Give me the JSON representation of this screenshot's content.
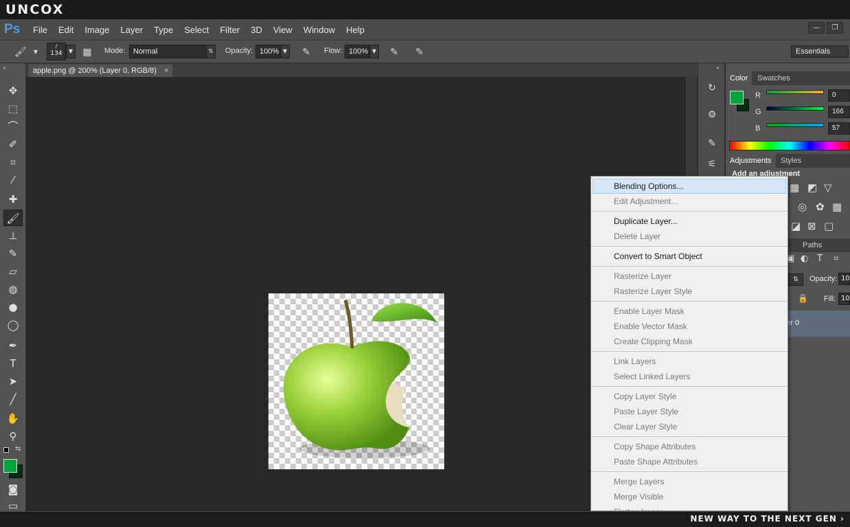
{
  "brand": {
    "logo": "UNCOX",
    "tagline": "NEW WAY TO THE NEXT GEN ›"
  },
  "app": {
    "logo": "Ps"
  },
  "menu": [
    "File",
    "Edit",
    "Image",
    "Layer",
    "Type",
    "Select",
    "Filter",
    "3D",
    "View",
    "Window",
    "Help"
  ],
  "window_controls": {
    "minimize": "—",
    "restore": "❐"
  },
  "options": {
    "brush_size": "134",
    "mode_label": "Mode:",
    "mode_value": "Normal",
    "opacity_label": "Opacity:",
    "opacity_value": "100%",
    "flow_label": "Flow:",
    "flow_value": "100%",
    "workspace": "Essentials"
  },
  "document": {
    "tab_title": "apple.png @ 200% (Layer 0, RGB/8)",
    "close": "×"
  },
  "color_panel": {
    "tabs": [
      "Color",
      "Swatches"
    ],
    "r_label": "R",
    "r_value": "0",
    "g_label": "G",
    "g_value": "166",
    "b_label": "B",
    "b_value": "57",
    "foreground": "#00a639",
    "background": "#003010"
  },
  "adjustments_panel": {
    "tabs": [
      "Adjustments",
      "Styles"
    ],
    "heading": "Add an adjustment"
  },
  "layers_panel": {
    "tab": "Paths",
    "opacity_label": "Opacity:",
    "opacity_value": "10",
    "fill_label": "Fill:",
    "fill_value": "10",
    "layer_name": "er 0"
  },
  "context_menu": {
    "groups": [
      [
        {
          "label": "Blending Options...",
          "state": "highlight"
        },
        {
          "label": "Edit Adjustment...",
          "state": "disabled"
        }
      ],
      [
        {
          "label": "Duplicate Layer...",
          "state": "enabled"
        },
        {
          "label": "Delete Layer",
          "state": "disabled"
        }
      ],
      [
        {
          "label": "Convert to Smart Object",
          "state": "enabled"
        }
      ],
      [
        {
          "label": "Rasterize Layer",
          "state": "disabled"
        },
        {
          "label": "Rasterize Layer Style",
          "state": "disabled"
        }
      ],
      [
        {
          "label": "Enable Layer Mask",
          "state": "disabled"
        },
        {
          "label": "Enable Vector Mask",
          "state": "disabled"
        },
        {
          "label": "Create Clipping Mask",
          "state": "disabled"
        }
      ],
      [
        {
          "label": "Link Layers",
          "state": "disabled"
        },
        {
          "label": "Select Linked Layers",
          "state": "disabled"
        }
      ],
      [
        {
          "label": "Copy Layer Style",
          "state": "disabled"
        },
        {
          "label": "Paste Layer Style",
          "state": "disabled"
        },
        {
          "label": "Clear Layer Style",
          "state": "disabled"
        }
      ],
      [
        {
          "label": "Copy Shape Attributes",
          "state": "disabled"
        },
        {
          "label": "Paste Shape Attributes",
          "state": "disabled"
        }
      ],
      [
        {
          "label": "Merge Layers",
          "state": "disabled"
        },
        {
          "label": "Merge Visible",
          "state": "disabled"
        },
        {
          "label": "Flatten Image",
          "state": "disabled"
        }
      ]
    ]
  },
  "tools": [
    "move-tool",
    "marquee-tool",
    "lasso-tool",
    "quick-select-tool",
    "crop-tool",
    "eyedropper-tool",
    "healing-tool",
    "brush-tool",
    "clone-stamp-tool",
    "history-brush-tool",
    "eraser-tool",
    "paint-bucket-tool",
    "blur-tool",
    "dodge-tool",
    "pen-tool",
    "type-tool",
    "path-select-tool",
    "line-tool",
    "hand-tool",
    "zoom-tool"
  ]
}
